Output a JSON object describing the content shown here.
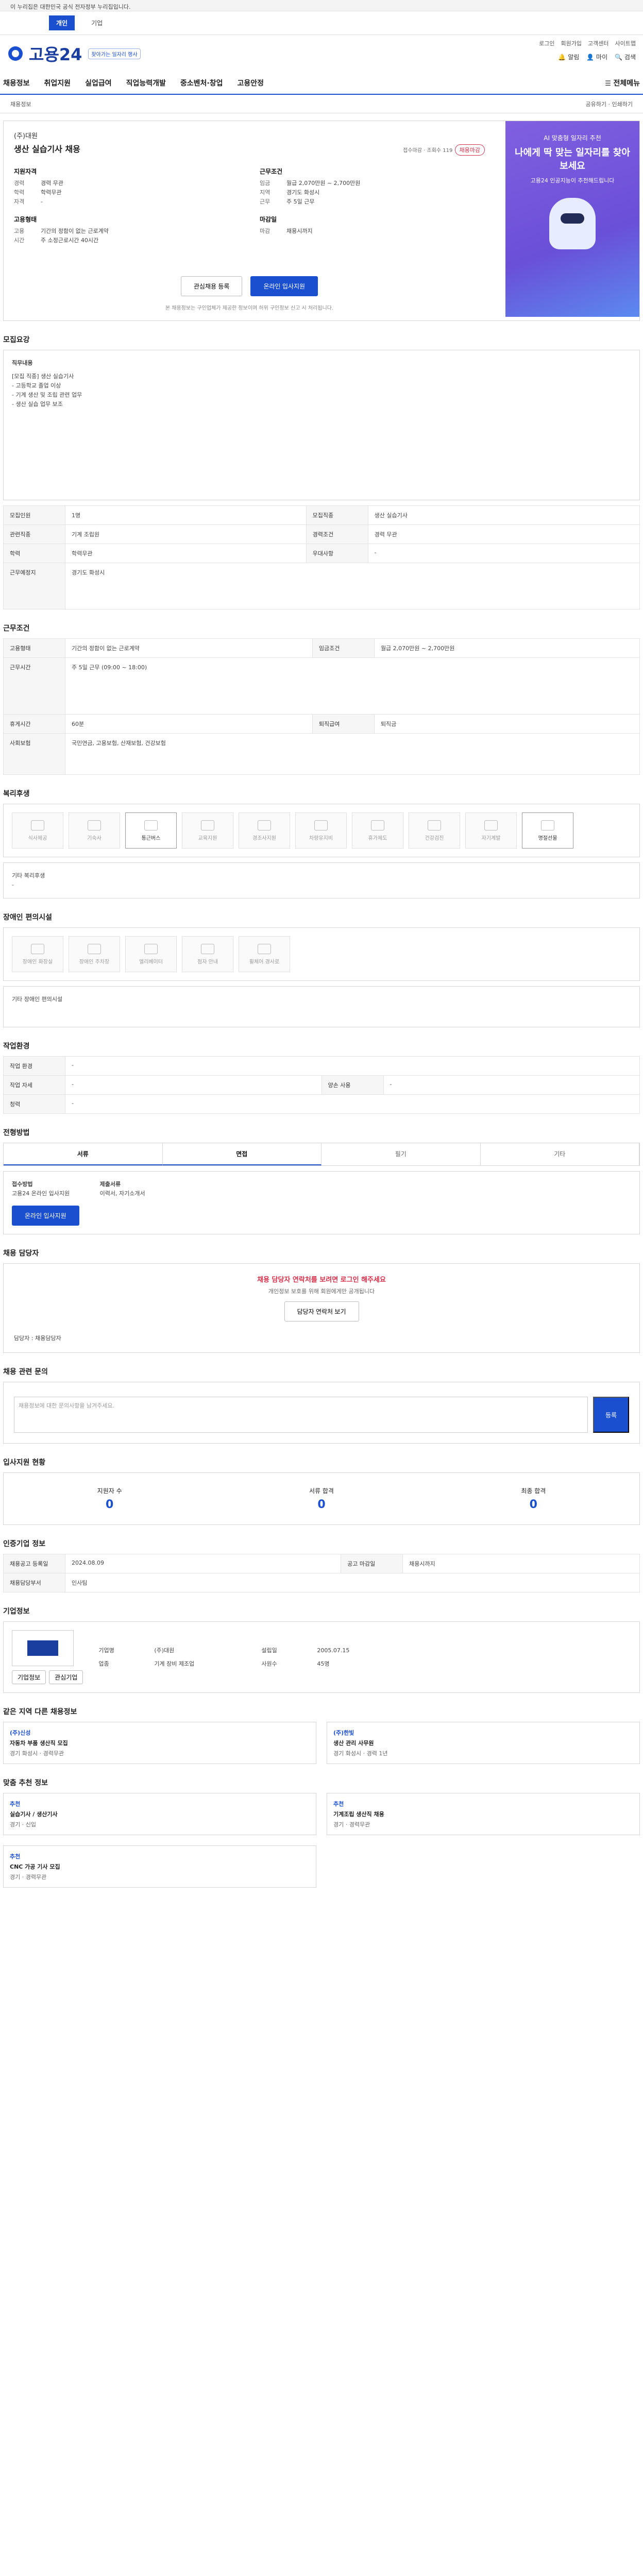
{
  "gov_banner": "이 누리집은 대한민국 공식 전자정부 누리집입니다.",
  "topnav": {
    "items": [
      "개인",
      "기업"
    ]
  },
  "header": {
    "logo_text": "고용24",
    "badge": "찾아가는 일자리 행사",
    "links": [
      "로그인",
      "회원가입",
      "고객센터",
      "사이트맵"
    ],
    "icons": [
      {
        "name": "bell-icon",
        "label": "알림"
      },
      {
        "name": "user-icon",
        "label": "마이"
      },
      {
        "name": "search-icon",
        "label": "검색"
      }
    ]
  },
  "gnb": {
    "items": [
      "채용정보",
      "취업지원",
      "실업급여",
      "직업능력개발",
      "중소벤처·창업",
      "고용안정"
    ],
    "all_menu": "전체메뉴"
  },
  "subnav": {
    "left": "채용정보",
    "right": [
      "공유하기",
      "인쇄하기"
    ]
  },
  "job": {
    "company": "(주)대원",
    "title": "생산 실습기사 채용",
    "badge": "채용마감",
    "status": "접수마감 · 조회수 119",
    "left_heading": "지원자격",
    "left_rows": [
      {
        "k": "경력",
        "v": "경력 무관"
      },
      {
        "k": "학력",
        "v": "학력무관"
      },
      {
        "k": "자격",
        "v": "-"
      }
    ],
    "right_heading": "근무조건",
    "right_rows": [
      {
        "k": "임금",
        "v": "월급 2,070만원 ~ 2,700만원"
      },
      {
        "k": "지역",
        "v": "경기도 화성시"
      },
      {
        "k": "근무",
        "v": "주 5일 근무"
      }
    ],
    "left_heading2": "고용형태",
    "left_rows2": [
      {
        "k": "고용",
        "v": "기간의 정함이 없는 근로계약"
      },
      {
        "k": "시간",
        "v": "주 소정근로시간 40시간"
      }
    ],
    "right_heading2": "마감일",
    "right_rows2": [
      {
        "k": "마감",
        "v": "채용시까지"
      }
    ],
    "btn_scrap": "관심채용 등록",
    "btn_apply": "온라인 입사지원",
    "notice": "본 채용정보는 구인업체가 제공한 정보이며 허위 구인정보 신고 시 처리됩니다."
  },
  "ad": {
    "line1": "AI 맞춤형 일자리 추천",
    "title": "나에게 딱 맞는 일자리를 찾아보세요",
    "sub": "고용24 인공지능이 추천해드립니다"
  },
  "sections": {
    "summary": "모집요강",
    "duties_label": "직무내용",
    "duties_text": [
      "[모집 직종] 생산 실습기사",
      "- 고등학교 졸업 이상",
      "- 기계 생산 및 조립 관련 업무",
      "- 생산 실습 업무 보조"
    ],
    "recruit_table": [
      {
        "k": "모집인원",
        "v": "1명"
      },
      {
        "k": "모집직종",
        "v": "생산 실습기사"
      },
      {
        "k": "관련직종",
        "v": "기계 조립원"
      },
      {
        "k": "경력조건",
        "v": "경력 무관"
      },
      {
        "k": "학력",
        "v": "학력무관"
      },
      {
        "k": "우대사항",
        "v": "-"
      },
      {
        "k": "근무예정지",
        "v": "경기도 화성시"
      }
    ],
    "conditions": "근무조건",
    "conditions_table": [
      {
        "k": "고용형태",
        "v": "기간의 정함이 없는 근로계약"
      },
      {
        "k": "임금조건",
        "v": "월급 2,070만원 ~ 2,700만원"
      },
      {
        "k": "근무시간",
        "v": "주 5일 근무 (09:00 ~ 18:00)"
      },
      {
        "k": "휴게시간",
        "v": "60분"
      },
      {
        "k": "사회보험",
        "v": "국민연금, 고용보험, 산재보험, 건강보험"
      },
      {
        "k": "퇴직급여",
        "v": "퇴직금"
      }
    ],
    "benefits": "복리후생",
    "benefit_icons": [
      "식사제공",
      "기숙사",
      "통근버스",
      "교육지원",
      "경조사지원",
      "차량유지비",
      "휴가제도",
      "건강검진",
      "자기계발",
      "명절선물"
    ],
    "benefit_on": [
      2,
      9
    ],
    "benefit_etc_label": "기타 복리후생",
    "benefit_etc": "-",
    "disability": "장애인 편의시설",
    "disability_icons": [
      "장애인 화장실",
      "장애인 주차장",
      "엘리베이터",
      "점자 안내",
      "휠체어 경사로"
    ],
    "disability_etc": "기타 장애인 편의시설",
    "env": "작업환경",
    "env_table": [
      {
        "k": "작업 환경",
        "v": "-"
      },
      {
        "k": "작업 자세",
        "v": "-"
      },
      {
        "k": "양손 사용",
        "v": "-"
      },
      {
        "k": "청력",
        "v": "-"
      }
    ],
    "process": "전형방법",
    "process_tabs": [
      "서류",
      "면접",
      "필기",
      "기타"
    ],
    "process_on": [
      0,
      1
    ],
    "apply_way_label": "접수방법",
    "apply_way": "고용24 온라인 입사지원",
    "apply_btn": "온라인 입사지원",
    "docs_label": "제출서류",
    "docs": "이력서, 자기소개서",
    "contact": "채용 담당자",
    "contact_notice": "채용 담당자 연락처를 보려면 로그인 해주세요",
    "contact_sub": "개인정보 보호를 위해 회원에게만 공개됩니다",
    "contact_btn": "담당자 연락처 보기",
    "contact_name_label": "담당자",
    "contact_name": "채용담당자",
    "inquiry": "채용 관련 문의",
    "inquiry_placeholder": "채용정보에 대한 문의사항을 남겨주세요.",
    "inquiry_btn": "등록",
    "apply_status": "입사지원 현황",
    "apply_steps": [
      {
        "label": "지원자 수",
        "value": "0"
      },
      {
        "label": "서류 합격",
        "value": "0"
      },
      {
        "label": "최종 합격",
        "value": "0"
      }
    ],
    "info": "인증기업 정보",
    "info_table": [
      {
        "k": "채용공고 등록일",
        "v": "2024.08.09"
      },
      {
        "k": "공고 마감일",
        "v": "채용시까지"
      },
      {
        "k": "채용담당부서",
        "v": "인사팀"
      }
    ],
    "company_info": "기업정보",
    "company_rows": [
      {
        "k": "기업명",
        "v": "(주)대원"
      },
      {
        "k": "업종",
        "v": "기계 장비 제조업"
      },
      {
        "k": "사원수",
        "v": "45명"
      },
      {
        "k": "설립일",
        "v": "2005.07.15"
      }
    ],
    "company_btns": [
      "기업정보",
      "관심기업"
    ],
    "related": "같은 지역 다른 채용정보",
    "related_items": [
      {
        "tag": "(주)신성",
        "title": "자동차 부품 생산직 모집",
        "meta": "경기 화성시 · 경력무관"
      },
      {
        "tag": "(주)한빛",
        "title": "생산 관리 사무원",
        "meta": "경기 화성시 · 경력 1년"
      }
    ],
    "recommend": "맞춤 추천 정보",
    "recommend_items": [
      {
        "tag": "추천",
        "title": "실습기사 / 생산기사",
        "meta": "경기 · 신입"
      },
      {
        "tag": "추천",
        "title": "기계조립 생산직 채용",
        "meta": "경기 · 경력무관"
      },
      {
        "tag": "추천",
        "title": "CNC 가공 기사 모집",
        "meta": "경기 · 경력무관"
      }
    ]
  }
}
